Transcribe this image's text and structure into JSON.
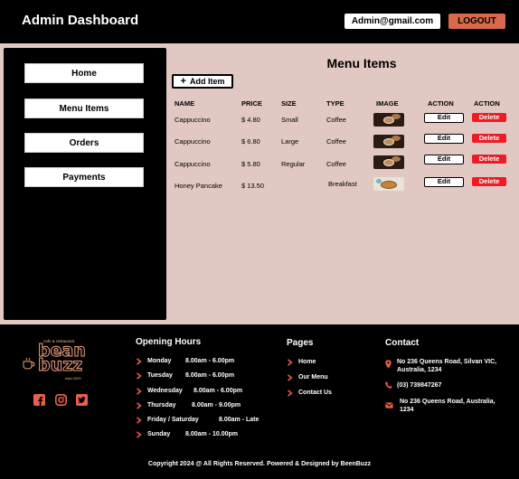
{
  "header": {
    "title": "Admin Dashboard",
    "email": "Admin@gmail.com",
    "logout_label": "LOGOUT"
  },
  "sidebar": {
    "items": [
      {
        "label": "Home"
      },
      {
        "label": "Menu Items"
      },
      {
        "label": "Orders"
      },
      {
        "label": "Payments"
      }
    ]
  },
  "main": {
    "heading": "Menu Items",
    "add_label": "Add Item",
    "columns": [
      "NAME",
      "PRICE",
      "SIZE",
      "TYPE",
      "IMAGE",
      "ACTION",
      "ACTION"
    ],
    "rows": [
      {
        "name": "Cappuccino",
        "price": "$ 4.80",
        "size": "Small",
        "type": "Coffee",
        "image": "coffee",
        "edit": "Edit",
        "delete": "Delete"
      },
      {
        "name": "Cappuccino",
        "price": "$ 6.80",
        "size": "Large",
        "type": "Coffee",
        "image": "coffee",
        "edit": "Edit",
        "delete": "Delete"
      },
      {
        "name": "Cappuccino",
        "price": "$ 5.80",
        "size": "Regular",
        "type": "Coffee",
        "image": "coffee",
        "edit": "Edit",
        "delete": "Delete"
      },
      {
        "name": "Honey Pancake",
        "price": "$ 13.50",
        "size": "",
        "type": "Breakfast",
        "image": "pancake",
        "edit": "Edit",
        "delete": "Delete"
      }
    ]
  },
  "footer": {
    "logo": {
      "tagline": "cafe & restaurant",
      "word1": "bean",
      "word2": "buzz",
      "est": "estd 2020"
    },
    "social": [
      "facebook-icon",
      "instagram-icon",
      "twitter-icon"
    ],
    "hours": {
      "title": "Opening Hours",
      "items": [
        {
          "day": "Monday",
          "time": "8.00am  -  6.00pm"
        },
        {
          "day": "Tuesday",
          "time": "8.00am  -  6.00pm"
        },
        {
          "day": "Wednesday",
          "time": "8.00am  -  6.00pm"
        },
        {
          "day": "Thursday",
          "time": "8.00am  -  9.00pm"
        },
        {
          "day": "Friday  /  Saturday",
          "time": "8.00am  -  Late"
        },
        {
          "day": "Sunday",
          "time": "8.00am  -  10.00pm"
        }
      ]
    },
    "pages": {
      "title": "Pages",
      "items": [
        "Home",
        "Our Menu",
        "Contact Us"
      ]
    },
    "contact": {
      "title": "Contact",
      "address1_l1": "No 236 Queens Road, Silvan VIC,",
      "address1_l2": "Australia, 1234",
      "phone": "(03) 739847267",
      "address2_l1": "No 236 Queens Road,  Australia,",
      "address2_l2": "1234"
    },
    "copyright": "Copyright 2024 @ All Rights Reserved. Powered & Designed by BeenBuzz"
  },
  "colors": {
    "accent": "#d9694a",
    "delete": "#ee1c25",
    "main_bg": "#e1c8c2"
  }
}
